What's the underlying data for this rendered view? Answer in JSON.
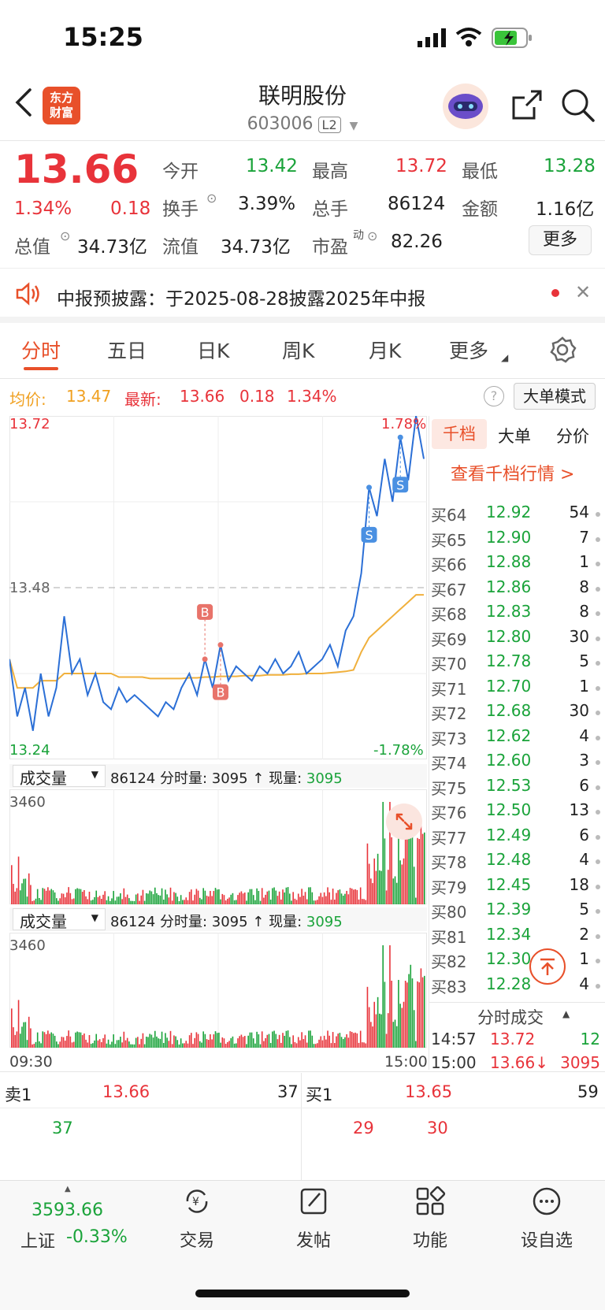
{
  "status": {
    "time": "15:25"
  },
  "header": {
    "title": "联明股份",
    "code": "603006",
    "level": "L2",
    "logo_text_1": "东方",
    "logo_text_2": "财富"
  },
  "quote": {
    "price": "13.66",
    "change_pct": "1.34%",
    "change": "0.18",
    "open_label": "今开",
    "open": "13.42",
    "high_label": "最高",
    "high": "13.72",
    "low_label": "最低",
    "low": "13.28",
    "turnover_label": "换手",
    "turnover": "3.39%",
    "volume_label": "总手",
    "volume": "86124",
    "amount_label": "金额",
    "amount": "1.16亿",
    "mcap_label": "总值",
    "mcap": "34.73亿",
    "float_label": "流值",
    "float": "34.73亿",
    "pe_label": "市盈",
    "pe_sup": "动",
    "pe": "82.26",
    "more": "更多"
  },
  "notice": {
    "text": "中报预披露：于2025-08-28披露2025年中报"
  },
  "tabs": [
    "分时",
    "五日",
    "日K",
    "周K",
    "月K",
    "更多"
  ],
  "chart_info": {
    "avg_label": "均价:",
    "avg": "13.47",
    "last_label": "最新:",
    "last": "13.66",
    "chg": "0.18",
    "pct": "1.34%",
    "big_order_mode": "大单模式"
  },
  "chart_data": {
    "type": "line",
    "ylim": [
      13.24,
      13.72
    ],
    "y_labels": {
      "top": "13.72",
      "mid": "13.48",
      "bottom": "13.24",
      "top_pct": "1.78%",
      "bottom_pct": "-1.78%"
    },
    "x_labels": [
      "09:30",
      "15:00"
    ],
    "series": [
      {
        "name": "最新",
        "values": [
          13.38,
          13.3,
          13.34,
          13.28,
          13.36,
          13.3,
          13.34,
          13.44,
          13.36,
          13.38,
          13.33,
          13.36,
          13.32,
          13.31,
          13.34,
          13.32,
          13.33,
          13.32,
          13.31,
          13.3,
          13.32,
          13.31,
          13.34,
          13.36,
          13.33,
          13.38,
          13.34,
          13.4,
          13.35,
          13.37,
          13.36,
          13.35,
          13.37,
          13.36,
          13.38,
          13.36,
          13.37,
          13.39,
          13.36,
          13.37,
          13.38,
          13.4,
          13.37,
          13.42,
          13.44,
          13.5,
          13.62,
          13.58,
          13.66,
          13.6,
          13.69,
          13.63,
          13.72,
          13.66
        ]
      },
      {
        "name": "均价",
        "values": [
          13.38,
          13.34,
          13.34,
          13.34,
          13.35,
          13.35,
          13.35,
          13.36,
          13.36,
          13.36,
          13.36,
          13.36,
          13.36,
          13.36,
          13.355,
          13.355,
          13.355,
          13.355,
          13.353,
          13.353,
          13.353,
          13.353,
          13.353,
          13.354,
          13.354,
          13.355,
          13.355,
          13.356,
          13.356,
          13.356,
          13.357,
          13.357,
          13.357,
          13.358,
          13.358,
          13.358,
          13.359,
          13.359,
          13.36,
          13.36,
          13.36,
          13.361,
          13.362,
          13.363,
          13.365,
          13.39,
          13.41,
          13.42,
          13.43,
          13.44,
          13.45,
          13.46,
          13.47,
          13.47
        ]
      }
    ],
    "volume_max": "3460",
    "volume_label": "成交量",
    "volume_info": "86124 分时量: 3095 ↑ 现量: ",
    "volume_now": "3095"
  },
  "side": {
    "tabs": [
      "千档",
      "大单",
      "分价"
    ],
    "link": "查看千档行情 >",
    "rows": [
      {
        "label": "买64",
        "price": "12.92",
        "qty": "54"
      },
      {
        "label": "买65",
        "price": "12.90",
        "qty": "7"
      },
      {
        "label": "买66",
        "price": "12.88",
        "qty": "1"
      },
      {
        "label": "买67",
        "price": "12.86",
        "qty": "8"
      },
      {
        "label": "买68",
        "price": "12.83",
        "qty": "8"
      },
      {
        "label": "买69",
        "price": "12.80",
        "qty": "30"
      },
      {
        "label": "买70",
        "price": "12.78",
        "qty": "5"
      },
      {
        "label": "买71",
        "price": "12.70",
        "qty": "1"
      },
      {
        "label": "买72",
        "price": "12.68",
        "qty": "30"
      },
      {
        "label": "买73",
        "price": "12.62",
        "qty": "4"
      },
      {
        "label": "买74",
        "price": "12.60",
        "qty": "3"
      },
      {
        "label": "买75",
        "price": "12.53",
        "qty": "6"
      },
      {
        "label": "买76",
        "price": "12.50",
        "qty": "13"
      },
      {
        "label": "买77",
        "price": "12.49",
        "qty": "6"
      },
      {
        "label": "买78",
        "price": "12.48",
        "qty": "4"
      },
      {
        "label": "买79",
        "price": "12.45",
        "qty": "18"
      },
      {
        "label": "买80",
        "price": "12.39",
        "qty": "5"
      },
      {
        "label": "买81",
        "price": "12.34",
        "qty": "2"
      },
      {
        "label": "买82",
        "price": "12.30",
        "qty": "1"
      },
      {
        "label": "买83",
        "price": "12.28",
        "qty": "4"
      }
    ],
    "ticks_title": "分时成交",
    "ticks": [
      {
        "time": "14:57",
        "price": "13.72",
        "qty": "12"
      },
      {
        "time": "15:00",
        "price": "13.66↓",
        "qty": "3095"
      }
    ]
  },
  "orderbook": {
    "sell_label": "卖1",
    "sell_price": "13.66",
    "sell_qty": "37",
    "sell_sub": "37",
    "buy_label": "买1",
    "buy_price": "13.65",
    "buy_qty": "59",
    "buy_sub_1": "29",
    "buy_sub_2": "30"
  },
  "bottom": {
    "index_value": "3593.66",
    "index_name": "上证",
    "index_pct": "-0.33%",
    "nav": [
      "交易",
      "发帖",
      "功能",
      "设自选"
    ]
  },
  "colors": {
    "accent": "#e8502a",
    "up": "#e8333a",
    "down": "#1aa33a",
    "price_line": "#2b6fd6",
    "avg_line": "#f0b03c"
  }
}
